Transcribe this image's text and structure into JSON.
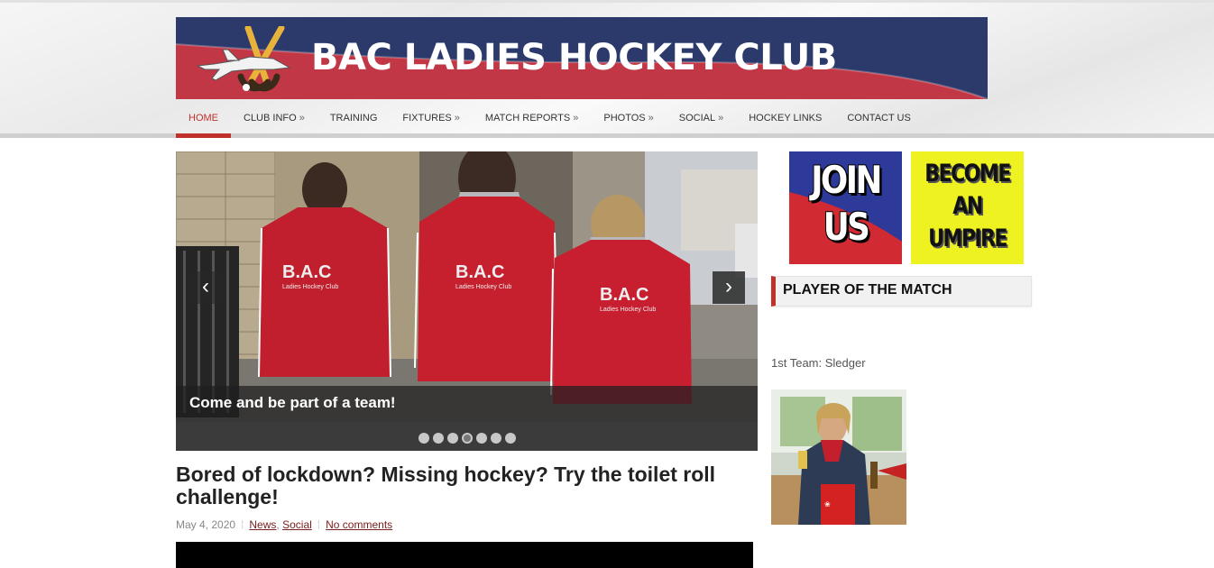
{
  "site": {
    "title": "BAC LADIES HOCKEY CLUB"
  },
  "nav": {
    "items": [
      {
        "label": "HOME",
        "active": true,
        "submenu": false
      },
      {
        "label": "CLUB INFO",
        "active": false,
        "submenu": true
      },
      {
        "label": "TRAINING",
        "active": false,
        "submenu": false
      },
      {
        "label": "FIXTURES",
        "active": false,
        "submenu": true
      },
      {
        "label": "MATCH REPORTS",
        "active": false,
        "submenu": true
      },
      {
        "label": "PHOTOS",
        "active": false,
        "submenu": true
      },
      {
        "label": "SOCIAL",
        "active": false,
        "submenu": true
      },
      {
        "label": "HOCKEY LINKS",
        "active": false,
        "submenu": false
      },
      {
        "label": "CONTACT US",
        "active": false,
        "submenu": false
      }
    ],
    "submenu_marker": "»"
  },
  "slider": {
    "caption": "Come and be part of a team!",
    "prev_icon": "‹",
    "next_icon": "›",
    "slide_count": 7,
    "current_slide": 4,
    "jacket_text": "B.A.C",
    "jacket_subtext": "Ladies Hockey Club"
  },
  "post": {
    "title": "Bored of lockdown? Missing hockey? Try the toilet roll challenge!",
    "date": "May 4, 2020",
    "categories": [
      "News",
      "Social"
    ],
    "category_sep": ",",
    "comments": "No comments"
  },
  "sidebar": {
    "join": {
      "line1": "JOIN",
      "line2": "US"
    },
    "umpire": {
      "line1": "BECOME",
      "line2": "AN",
      "line3": "UMPIRE"
    },
    "widget_title": "PLAYER OF THE MATCH",
    "potm_text": "1st Team: Sledger"
  },
  "colors": {
    "brand_red": "#c0312b",
    "banner_red": "#c23745",
    "banner_navy": "#2b3a6b",
    "umpire_yellow": "#eef220"
  }
}
